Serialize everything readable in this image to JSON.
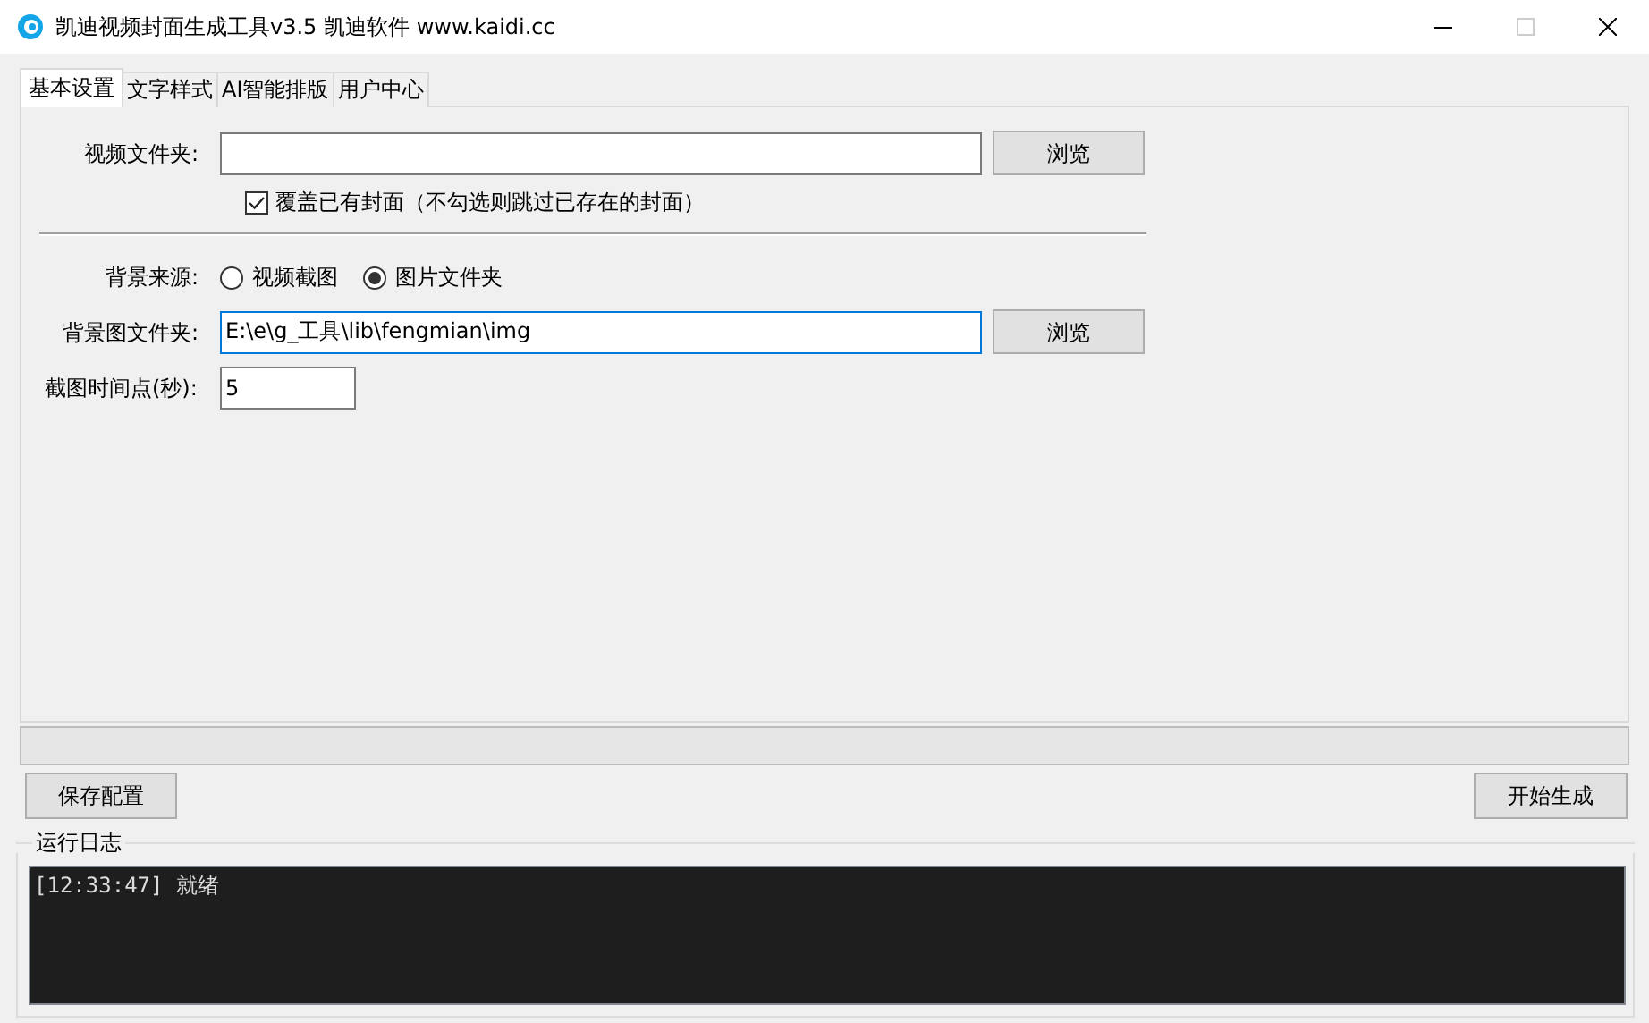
{
  "window": {
    "title": "凯迪视频封面生成工具v3.5 凯迪软件 www.kaidi.cc"
  },
  "tabs": [
    {
      "label": "基本设置",
      "selected": true
    },
    {
      "label": "文字样式",
      "selected": false
    },
    {
      "label": "AI智能排版",
      "selected": false
    },
    {
      "label": "用户中心",
      "selected": false
    }
  ],
  "video_folder": {
    "label": "视频文件夹:",
    "browse": "浏览"
  },
  "overwrite": {
    "label": "覆盖已有封面（不勾选则跳过已存在的封面）",
    "checked": true
  },
  "background_source": {
    "label": "背景来源:",
    "options": [
      {
        "label": "视频截图",
        "selected": false
      },
      {
        "label": "图片文件夹",
        "selected": true
      }
    ]
  },
  "background_folder": {
    "label": "背景图文件夹:",
    "value": "E:\\e\\g_工具\\lib\\fengmian\\img",
    "browse": "浏览",
    "focused": true
  },
  "capture_time": {
    "label": "截图时间点(秒):",
    "value": "5"
  },
  "progress": {
    "level": 0
  },
  "buttons": {
    "save": "保存配置",
    "start": "开始生成"
  },
  "log": {
    "title": "运行日志",
    "lines": [
      "[12:33:47] 就绪"
    ]
  }
}
